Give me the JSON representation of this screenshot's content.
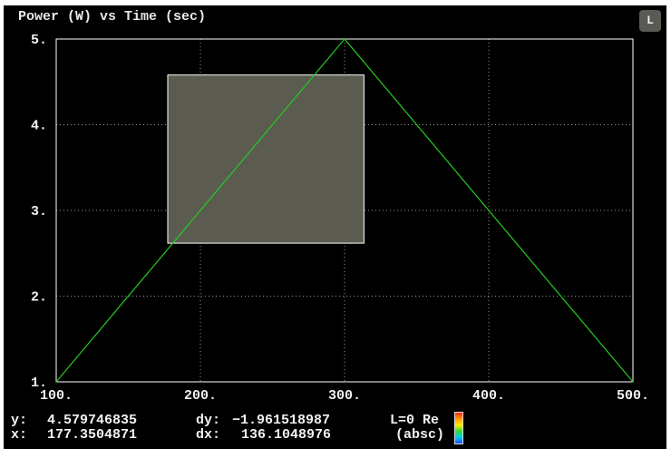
{
  "chart_data": {
    "type": "line",
    "title": "Power (W) vs Time (sec)",
    "xlim": [
      100,
      500
    ],
    "ylim": [
      1,
      5
    ],
    "x_ticks": [
      100,
      200,
      300,
      400,
      500
    ],
    "x_tick_labels": [
      "100.",
      "200.",
      "300.",
      "400.",
      "500."
    ],
    "y_ticks": [
      1,
      2,
      3,
      4,
      5
    ],
    "y_tick_labels": [
      "1.",
      "2.",
      "3.",
      "4.",
      "5."
    ],
    "grid": true,
    "series": [
      {
        "x": [
          100,
          300,
          500
        ],
        "y": [
          1,
          5,
          1
        ],
        "color": "#22cc22"
      }
    ],
    "selection_box": {
      "x": [
        177.35,
        313.45
      ],
      "y": [
        2.618,
        4.58
      ]
    }
  },
  "readout": {
    "y_label": "y:",
    "y_value": "4.579746835",
    "x_label": "x:",
    "x_value": "177.3504871",
    "dy_label": "dy:",
    "dy_value": "−1.961518987",
    "dx_label": "dx:",
    "dx_value": "136.1048976",
    "mode_line1": "L=0 Re",
    "mode_line2": "(absc)"
  },
  "legend_button_label": "L",
  "colors": {
    "background": "#000000",
    "line": "#22cc22",
    "grid": "#9a9a9a",
    "box_fill": "#5b5b50",
    "box_stroke": "#ffffff"
  }
}
